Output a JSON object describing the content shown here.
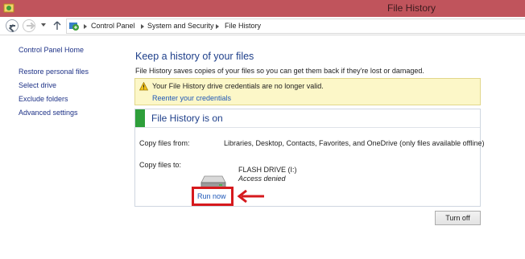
{
  "window": {
    "title": "File History"
  },
  "address_bar": {
    "breadcrumbs": [
      "Control Panel",
      "System and Security",
      "File History"
    ]
  },
  "sidebar": {
    "items": [
      {
        "label": "Control Panel Home"
      },
      {
        "label": "Restore personal files"
      },
      {
        "label": "Select drive"
      },
      {
        "label": "Exclude folders"
      },
      {
        "label": "Advanced settings"
      }
    ]
  },
  "main": {
    "title": "Keep a history of your files",
    "description": "File History saves copies of your files so you can get them back if they're lost or damaged.",
    "warning": {
      "message": "Your File History drive credentials are no longer valid.",
      "link": "Reenter your credentials"
    },
    "status": {
      "title": "File History is on",
      "status_color": "#2e9f3a",
      "copy_from_label": "Copy files from:",
      "copy_from_value": "Libraries, Desktop, Contacts, Favorites, and OneDrive (only files available offline)",
      "copy_to_label": "Copy files to:",
      "drive_name": "FLASH DRIVE (I:)",
      "drive_status": "Access denied",
      "run_now": "Run now"
    },
    "turn_off": "Turn off"
  },
  "annotation": {
    "highlight_color": "#d6191d"
  }
}
